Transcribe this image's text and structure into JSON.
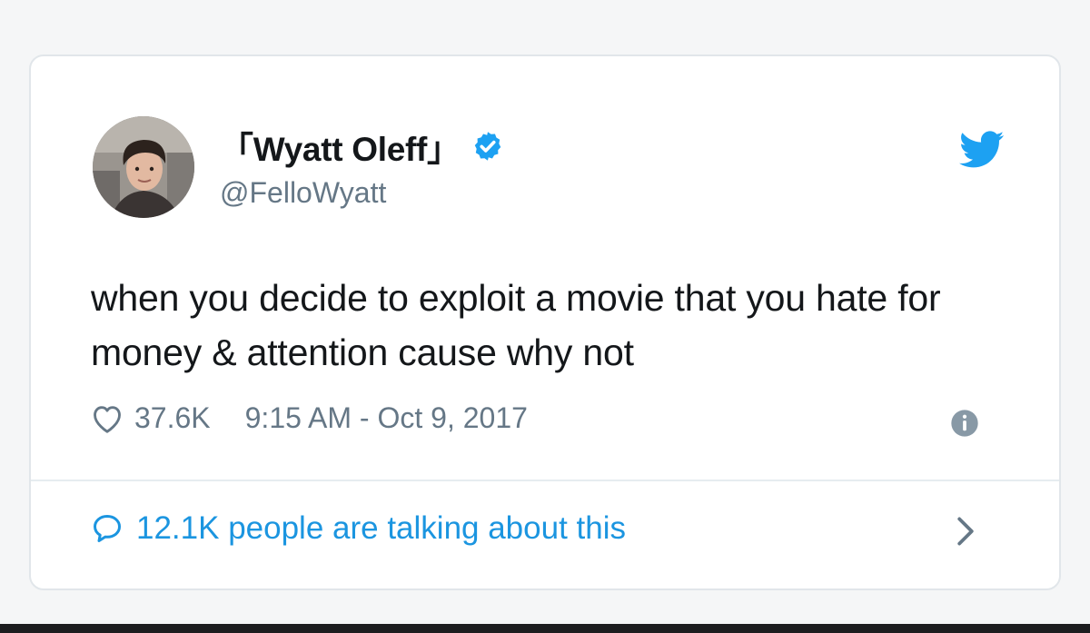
{
  "tweet": {
    "display_name": "「Wyatt Oleff」",
    "verified": true,
    "handle": "@FelloWyatt",
    "text": "when you decide to exploit a movie that you hate for money & attention cause why not",
    "likes": "37.6K",
    "timestamp": "9:15 AM - Oct 9, 2017",
    "talking": "12.1K people are talking about this"
  },
  "icons": {
    "brand": "twitter-bird-icon",
    "verified": "verified-badge-icon",
    "likes": "heart-icon",
    "info": "info-icon",
    "talking": "reply-bubble-icon",
    "more": "chevron-right-icon"
  },
  "colors": {
    "brand_blue": "#1da1f2",
    "link_blue": "#1b95e0",
    "text_primary": "#14171a",
    "text_secondary": "#657786",
    "card_border": "#e1e6ea"
  }
}
